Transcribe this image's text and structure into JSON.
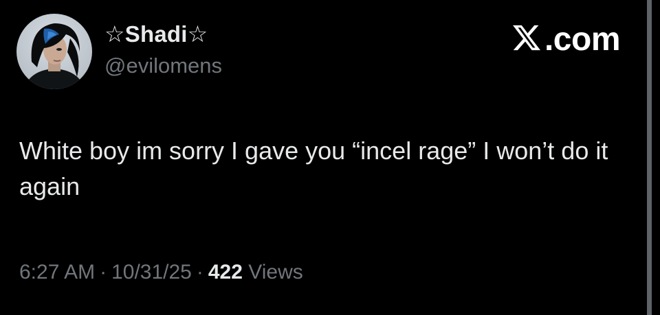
{
  "author": {
    "display_name": "☆Shadi☆",
    "handle": "@evilomens",
    "avatar_icon": "profile-photo"
  },
  "brand": {
    "text": ".com",
    "icon": "x-logo-icon",
    "color": "#ffffff"
  },
  "tweet": {
    "text": "White boy im sorry I gave you “incel rage” I won’t do it again"
  },
  "meta": {
    "time": "6:27 AM",
    "separator": "·",
    "date": "10/31/25",
    "views_count": "422",
    "views_label": "Views"
  },
  "colors": {
    "background": "#000000",
    "primary_text": "#e7e9ea",
    "secondary_text": "#71767b"
  }
}
